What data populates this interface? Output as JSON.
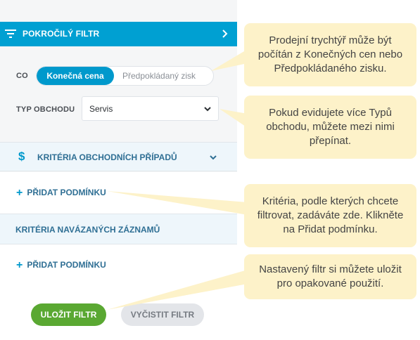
{
  "header": {
    "title": "POKROČILÝ FILTR"
  },
  "co": {
    "label": "CO",
    "options": [
      "Konečná cena",
      "Předpokládaný zisk"
    ],
    "selected": "Konečná cena"
  },
  "deal_type": {
    "label": "TYP OBCHODU",
    "value": "Servis"
  },
  "deal_criteria": {
    "title": "KRITÉRIA OBCHODNÍCH PŘÍPADŮ",
    "icon": "$",
    "add_label": "PŘIDAT PODMÍNKU"
  },
  "linked_criteria": {
    "title": "KRITÉRIA NAVÁZANÝCH ZÁZNAMŮ",
    "add_label": "PŘIDAT PODMÍNKU"
  },
  "buttons": {
    "save": "ULOŽIT FILTR",
    "clear": "VYČISTIT FILTR"
  },
  "callouts": {
    "c1": "Prodejní trychtýř může být počítán z Konečných cen nebo Předpokládaného zisku.",
    "c2": "Pokud evidujete více Typů obchodu, můžete mezi nimi přepínat.",
    "c3": "Kritéria, podle kterých chcete filtrovat, zadáváte zde. Klikněte na Přidat podmínku.",
    "c4": "Nastavený filtr si můžete uložit pro opakované použití."
  },
  "colors": {
    "header": "#00a0d2",
    "accent": "#0099cc",
    "save": "#5aa832",
    "callout": "#fdf2c9"
  }
}
